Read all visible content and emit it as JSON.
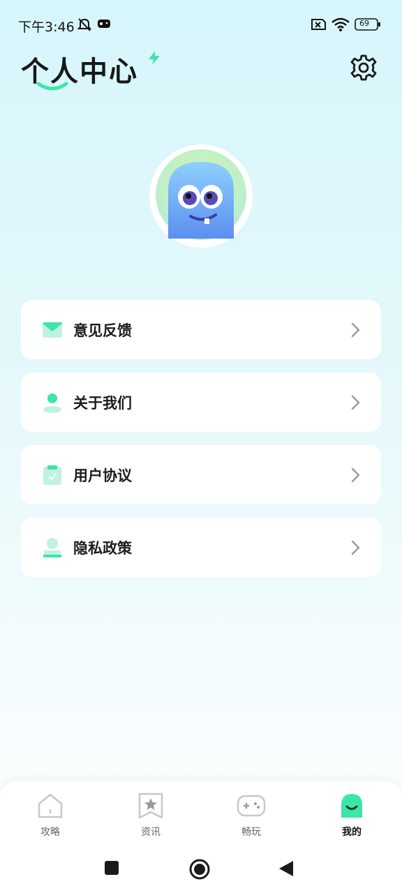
{
  "status_bar": {
    "time": "下午3:46",
    "battery_level": "69",
    "icons": [
      "mute-bell-icon",
      "gamepad-icon",
      "sim-off-icon",
      "wifi-icon",
      "battery-icon"
    ]
  },
  "header": {
    "title": "个人中心",
    "settings_icon": "gear-icon"
  },
  "avatar": {
    "icon": "blue-monster-avatar"
  },
  "menu": {
    "items": [
      {
        "label": "意见反馈",
        "icon": "envelope-icon"
      },
      {
        "label": "关于我们",
        "icon": "person-icon"
      },
      {
        "label": "用户协议",
        "icon": "clipboard-icon"
      },
      {
        "label": "隐私政策",
        "icon": "user-stamp-icon"
      }
    ]
  },
  "bottom_nav": {
    "items": [
      {
        "label": "攻略",
        "icon": "home-icon",
        "active": false
      },
      {
        "label": "资讯",
        "icon": "star-bookmark-icon",
        "active": false
      },
      {
        "label": "畅玩",
        "icon": "gamepad-icon",
        "active": false
      },
      {
        "label": "我的",
        "icon": "smile-face-icon",
        "active": true
      }
    ],
    "accent_color": "#3ee5a8"
  },
  "system_nav": {
    "buttons": [
      "recent-apps-square-icon",
      "home-circle-icon",
      "back-triangle-icon"
    ]
  },
  "colors": {
    "accent": "#3ee5a8",
    "background_top": "#d6f6fb",
    "text": "#1c1c1c"
  }
}
